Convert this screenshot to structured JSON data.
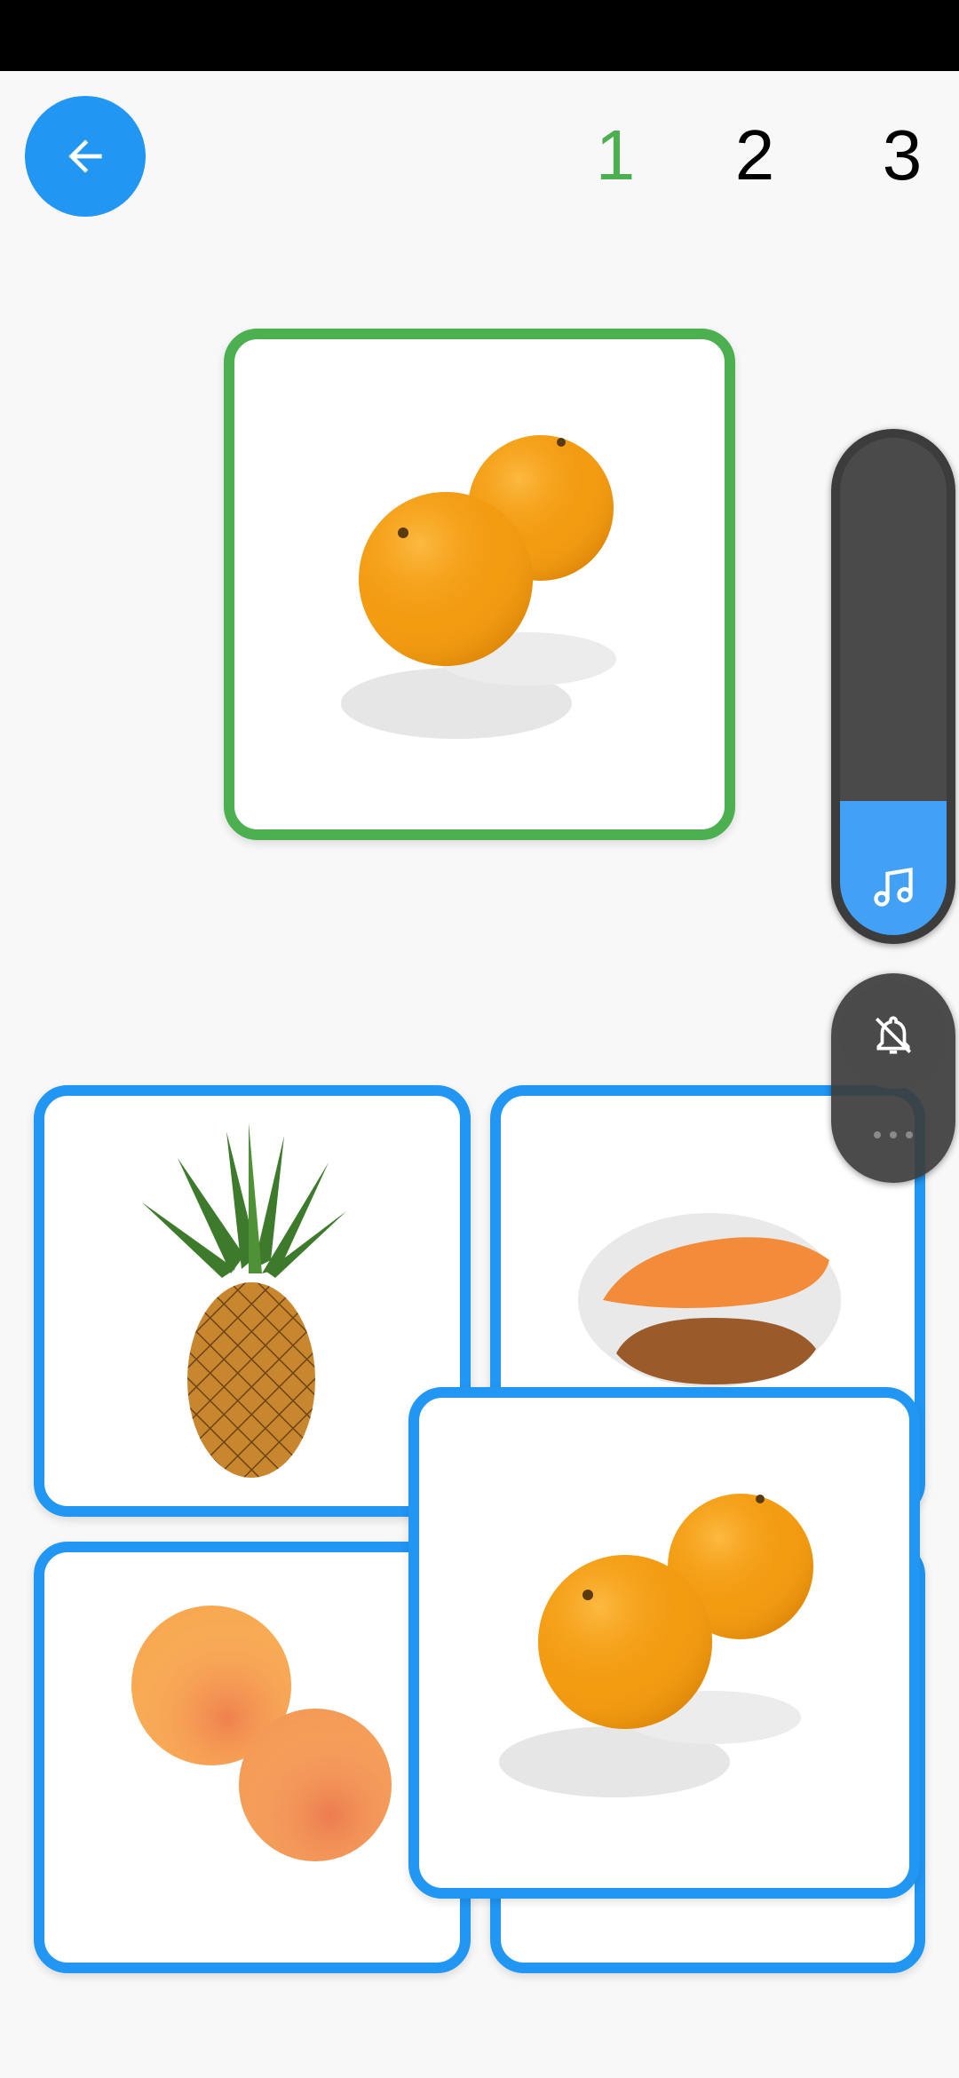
{
  "header": {
    "back_icon": "arrow-left-icon",
    "steps": [
      "1",
      "2",
      "3"
    ],
    "active_step_color": "#4caf50"
  },
  "colors": {
    "accent": "#2196f3",
    "target_border": "#4caf50",
    "panel": "#3c3c3c"
  },
  "target": {
    "fruit": "orange"
  },
  "choices": [
    "pineapple",
    "sweet-potato",
    "peach",
    "orange"
  ],
  "dragged": {
    "fruit": "orange"
  },
  "volume_panel": {
    "icon": "music-note-icon",
    "level": 0.27
  },
  "ringer_panel": {
    "icon": "bell-off-icon",
    "more_icon": "more-horizontal-icon"
  }
}
